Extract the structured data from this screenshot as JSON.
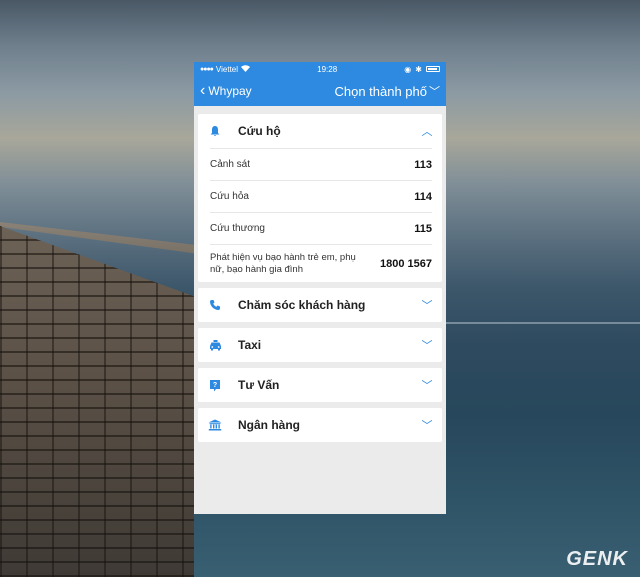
{
  "status_bar": {
    "carrier": "Viettel",
    "time": "19:28"
  },
  "nav": {
    "back_label": "Whypay",
    "city_selector": "Chọn thành phố"
  },
  "sections": [
    {
      "title": "Cứu hộ",
      "icon": "rescue-bell-icon",
      "expanded": true,
      "rows": [
        {
          "label": "Cảnh sát",
          "value": "113"
        },
        {
          "label": "Cứu hỏa",
          "value": "114"
        },
        {
          "label": "Cứu thương",
          "value": "115"
        },
        {
          "label": "Phát hiện vụ bạo hành trẻ em, phụ nữ, bạo hành gia đình",
          "value": "1800 1567"
        }
      ]
    },
    {
      "title": "Chăm sóc khách hàng",
      "icon": "phone-icon",
      "expanded": false
    },
    {
      "title": "Taxi",
      "icon": "taxi-icon",
      "expanded": false
    },
    {
      "title": "Tư Vấn",
      "icon": "question-icon",
      "expanded": false
    },
    {
      "title": "Ngân hàng",
      "icon": "bank-icon",
      "expanded": false
    }
  ],
  "colors": {
    "accent": "#2d8ae0",
    "background": "#ebebeb"
  },
  "watermark": "GENK"
}
